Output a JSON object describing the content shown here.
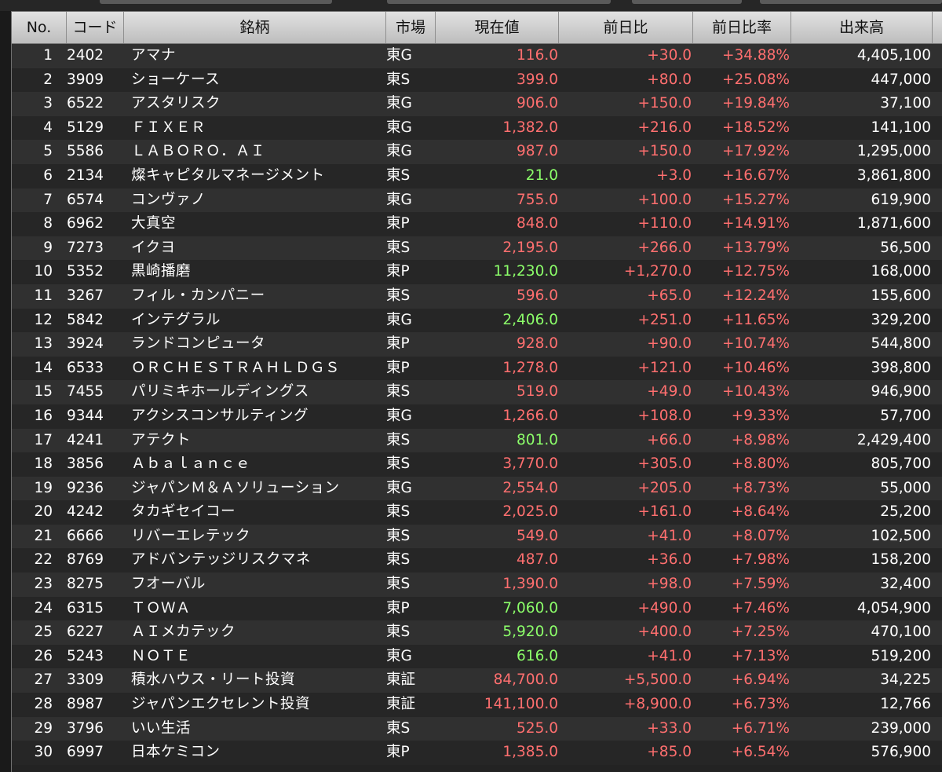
{
  "colors": {
    "up_red": "#ff6f6f",
    "highlight_green": "#8cff6a",
    "header_bg": "#cfcfcf",
    "row_odd": "#303030",
    "row_even": "#262626"
  },
  "columns": {
    "no": "No.",
    "code": "コード",
    "name": "銘柄",
    "market": "市場",
    "price": "現在値",
    "change": "前日比",
    "change_pct": "前日比率",
    "volume": "出来高"
  },
  "rows": [
    {
      "no": "1",
      "code": "2402",
      "name": "アマナ",
      "market": "東G",
      "price": "116.0",
      "price_color": "red",
      "change": "+30.0",
      "pct": "+34.88%",
      "volume": "4,405,100"
    },
    {
      "no": "2",
      "code": "3909",
      "name": "ショーケース",
      "market": "東S",
      "price": "399.0",
      "price_color": "red",
      "change": "+80.0",
      "pct": "+25.08%",
      "volume": "447,000"
    },
    {
      "no": "3",
      "code": "6522",
      "name": "アスタリスク",
      "market": "東G",
      "price": "906.0",
      "price_color": "red",
      "change": "+150.0",
      "pct": "+19.84%",
      "volume": "37,100"
    },
    {
      "no": "4",
      "code": "5129",
      "name": "ＦＩＸＥＲ",
      "market": "東G",
      "price": "1,382.0",
      "price_color": "red",
      "change": "+216.0",
      "pct": "+18.52%",
      "volume": "141,100"
    },
    {
      "no": "5",
      "code": "5586",
      "name": "ＬＡＢＯＲＯ．ＡＩ",
      "market": "東G",
      "price": "987.0",
      "price_color": "red",
      "change": "+150.0",
      "pct": "+17.92%",
      "volume": "1,295,000"
    },
    {
      "no": "6",
      "code": "2134",
      "name": "燦キャピタルマネージメント",
      "market": "東S",
      "price": "21.0",
      "price_color": "green",
      "change": "+3.0",
      "pct": "+16.67%",
      "volume": "3,861,800"
    },
    {
      "no": "7",
      "code": "6574",
      "name": "コンヴァノ",
      "market": "東G",
      "price": "755.0",
      "price_color": "red",
      "change": "+100.0",
      "pct": "+15.27%",
      "volume": "619,900"
    },
    {
      "no": "8",
      "code": "6962",
      "name": "大真空",
      "market": "東P",
      "price": "848.0",
      "price_color": "red",
      "change": "+110.0",
      "pct": "+14.91%",
      "volume": "1,871,600"
    },
    {
      "no": "9",
      "code": "7273",
      "name": "イクヨ",
      "market": "東S",
      "price": "2,195.0",
      "price_color": "red",
      "change": "+266.0",
      "pct": "+13.79%",
      "volume": "56,500"
    },
    {
      "no": "10",
      "code": "5352",
      "name": "黒崎播磨",
      "market": "東P",
      "price": "11,230.0",
      "price_color": "green",
      "change": "+1,270.0",
      "pct": "+12.75%",
      "volume": "168,000"
    },
    {
      "no": "11",
      "code": "3267",
      "name": "フィル・カンパニー",
      "market": "東S",
      "price": "596.0",
      "price_color": "red",
      "change": "+65.0",
      "pct": "+12.24%",
      "volume": "155,600"
    },
    {
      "no": "12",
      "code": "5842",
      "name": "インテグラル",
      "market": "東G",
      "price": "2,406.0",
      "price_color": "green",
      "change": "+251.0",
      "pct": "+11.65%",
      "volume": "329,200"
    },
    {
      "no": "13",
      "code": "3924",
      "name": "ランドコンピュータ",
      "market": "東P",
      "price": "928.0",
      "price_color": "red",
      "change": "+90.0",
      "pct": "+10.74%",
      "volume": "544,800"
    },
    {
      "no": "14",
      "code": "6533",
      "name": "ＯＲＣＨＥＳＴＲＡＨＬＤＧＳ",
      "market": "東P",
      "price": "1,278.0",
      "price_color": "red",
      "change": "+121.0",
      "pct": "+10.46%",
      "volume": "398,800"
    },
    {
      "no": "15",
      "code": "7455",
      "name": "パリミキホールディングス",
      "market": "東S",
      "price": "519.0",
      "price_color": "red",
      "change": "+49.0",
      "pct": "+10.43%",
      "volume": "946,900"
    },
    {
      "no": "16",
      "code": "9344",
      "name": "アクシスコンサルティング",
      "market": "東G",
      "price": "1,266.0",
      "price_color": "red",
      "change": "+108.0",
      "pct": "+9.33%",
      "volume": "57,700"
    },
    {
      "no": "17",
      "code": "4241",
      "name": "アテクト",
      "market": "東S",
      "price": "801.0",
      "price_color": "green",
      "change": "+66.0",
      "pct": "+8.98%",
      "volume": "2,429,400"
    },
    {
      "no": "18",
      "code": "3856",
      "name": "Ａｂａｌａｎｃｅ",
      "market": "東S",
      "price": "3,770.0",
      "price_color": "red",
      "change": "+305.0",
      "pct": "+8.80%",
      "volume": "805,700"
    },
    {
      "no": "19",
      "code": "9236",
      "name": "ジャパンＭ＆Ａソリューション",
      "market": "東G",
      "price": "2,554.0",
      "price_color": "red",
      "change": "+205.0",
      "pct": "+8.73%",
      "volume": "55,000"
    },
    {
      "no": "20",
      "code": "4242",
      "name": "タカギセイコー",
      "market": "東S",
      "price": "2,025.0",
      "price_color": "red",
      "change": "+161.0",
      "pct": "+8.64%",
      "volume": "25,200"
    },
    {
      "no": "21",
      "code": "6666",
      "name": "リバーエレテック",
      "market": "東S",
      "price": "549.0",
      "price_color": "red",
      "change": "+41.0",
      "pct": "+8.07%",
      "volume": "102,500"
    },
    {
      "no": "22",
      "code": "8769",
      "name": "アドバンテッジリスクマネ",
      "market": "東S",
      "price": "487.0",
      "price_color": "red",
      "change": "+36.0",
      "pct": "+7.98%",
      "volume": "158,200"
    },
    {
      "no": "23",
      "code": "8275",
      "name": "フオーバル",
      "market": "東S",
      "price": "1,390.0",
      "price_color": "red",
      "change": "+98.0",
      "pct": "+7.59%",
      "volume": "32,400"
    },
    {
      "no": "24",
      "code": "6315",
      "name": "ＴＯＷＡ",
      "market": "東P",
      "price": "7,060.0",
      "price_color": "green",
      "change": "+490.0",
      "pct": "+7.46%",
      "volume": "4,054,900"
    },
    {
      "no": "25",
      "code": "6227",
      "name": "ＡＩメカテック",
      "market": "東S",
      "price": "5,920.0",
      "price_color": "green",
      "change": "+400.0",
      "pct": "+7.25%",
      "volume": "470,100"
    },
    {
      "no": "26",
      "code": "5243",
      "name": "ＮＯＴＥ",
      "market": "東G",
      "price": "616.0",
      "price_color": "green",
      "change": "+41.0",
      "pct": "+7.13%",
      "volume": "519,200"
    },
    {
      "no": "27",
      "code": "3309",
      "name": "積水ハウス・リート投資",
      "market": "東証",
      "price": "84,700.0",
      "price_color": "red",
      "change": "+5,500.0",
      "pct": "+6.94%",
      "volume": "34,225"
    },
    {
      "no": "28",
      "code": "8987",
      "name": "ジャパンエクセレント投資",
      "market": "東証",
      "price": "141,100.0",
      "price_color": "red",
      "change": "+8,900.0",
      "pct": "+6.73%",
      "volume": "12,766"
    },
    {
      "no": "29",
      "code": "3796",
      "name": "いい生活",
      "market": "東S",
      "price": "525.0",
      "price_color": "red",
      "change": "+33.0",
      "pct": "+6.71%",
      "volume": "239,000"
    },
    {
      "no": "30",
      "code": "6997",
      "name": "日本ケミコン",
      "market": "東P",
      "price": "1,385.0",
      "price_color": "red",
      "change": "+85.0",
      "pct": "+6.54%",
      "volume": "576,900"
    }
  ]
}
